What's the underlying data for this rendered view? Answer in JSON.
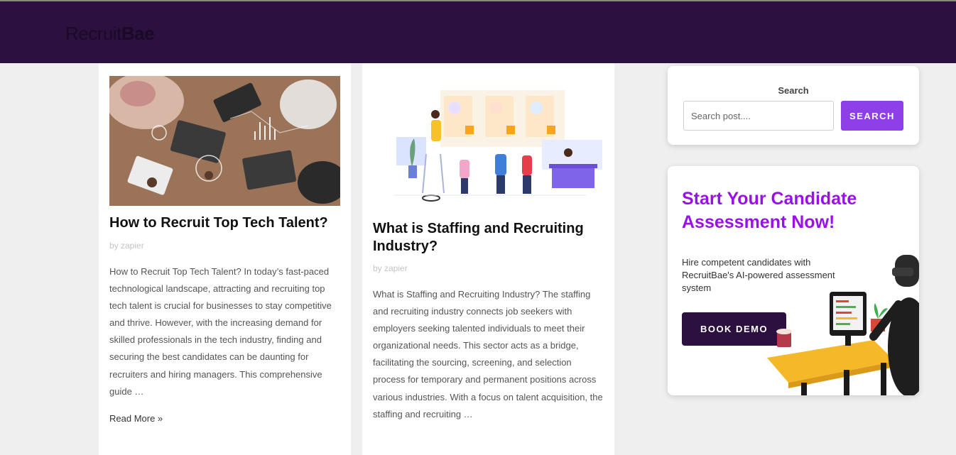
{
  "header": {
    "logo_regular": "Recruit",
    "logo_bold": "Bae"
  },
  "posts": [
    {
      "title": "How to Recruit Top Tech Talent?",
      "byline": "by zapier",
      "excerpt": "How to Recruit Top Tech Talent? In today’s fast-paced technological landscape, attracting and recruiting top tech talent is crucial for businesses to stay competitive and thrive. However, with the increasing demand for skilled professionals in the tech industry, finding and securing the best candidates can be daunting for recruiters and hiring managers. This comprehensive guide …",
      "read_more": "Read More »"
    },
    {
      "title": "What is Staffing and Recruiting Industry?",
      "byline": "by zapier",
      "excerpt": "What is Staffing and Recruiting Industry? The staffing and recruiting industry connects job seekers with employers seeking talented individuals to meet their organizational needs. This sector acts as a bridge, facilitating the sourcing, screening, and selection process for temporary and permanent positions across various industries. With a focus on talent acquisition, the staffing and recruiting …"
    }
  ],
  "sidebar": {
    "search": {
      "title": "Search",
      "placeholder": "Search post....",
      "button_label": "SEARCH"
    },
    "promo": {
      "title": "Start Your Candidate Assessment Now!",
      "subtitle": "Hire competent candidates with RecruitBae's AI-powered assessment system",
      "button_label": "BOOK DEMO"
    }
  },
  "colors": {
    "header_bg": "#2b1040",
    "accent_purple": "#8e3fe8",
    "promo_title": "#9a10e8",
    "page_bg": "#efefef"
  }
}
